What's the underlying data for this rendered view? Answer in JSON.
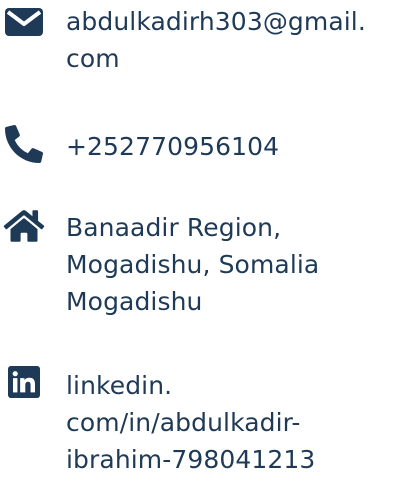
{
  "contact": {
    "email": {
      "icon": "envelope-icon",
      "line1": "abdulkadirh303@gmail.",
      "line2": "com"
    },
    "phone": {
      "icon": "phone-icon",
      "line1": "+252770956104"
    },
    "address": {
      "icon": "home-icon",
      "line1": "Banaadir Region,",
      "line2": "Mogadishu, Somalia",
      "line3": "Mogadishu"
    },
    "linkedin": {
      "icon": "linkedin-icon",
      "line1": "linkedin.",
      "line2": "com/in/abdulkadir-",
      "line3": "ibrahim-798041213"
    }
  },
  "colors": {
    "text": "#1f3a56",
    "icon": "#1f3a56",
    "background": "#ffffff"
  }
}
